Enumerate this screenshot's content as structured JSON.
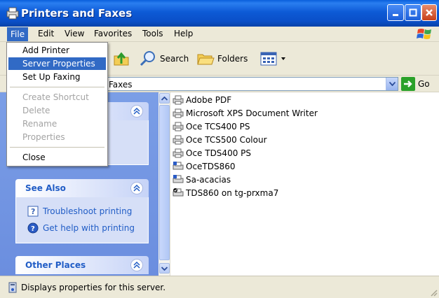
{
  "window": {
    "title": "Printers and Faxes"
  },
  "menubar": {
    "items": [
      {
        "label": "File"
      },
      {
        "label": "Edit"
      },
      {
        "label": "View"
      },
      {
        "label": "Favorites"
      },
      {
        "label": "Tools"
      },
      {
        "label": "Help"
      }
    ]
  },
  "toolbar": {
    "search_label": "Search",
    "folders_label": "Folders"
  },
  "address": {
    "value": "Faxes",
    "go_label": "Go"
  },
  "file_menu": {
    "items": [
      {
        "label": "Add Printer",
        "enabled": true,
        "highlighted": false
      },
      {
        "label": "Server Properties",
        "enabled": true,
        "highlighted": true
      },
      {
        "label": "Set Up Faxing",
        "enabled": true,
        "highlighted": false
      },
      {
        "label": "Create Shortcut",
        "enabled": false,
        "highlighted": false
      },
      {
        "label": "Delete",
        "enabled": false,
        "highlighted": false
      },
      {
        "label": "Rename",
        "enabled": false,
        "highlighted": false
      },
      {
        "label": "Properties",
        "enabled": false,
        "highlighted": false
      },
      {
        "label": "Close",
        "enabled": true,
        "highlighted": false
      }
    ]
  },
  "taskpane": {
    "see_also": {
      "title": "See Also",
      "links": [
        {
          "label": "Troubleshoot printing"
        },
        {
          "label": "Get help with printing"
        }
      ]
    },
    "other_places": {
      "title": "Other Places"
    }
  },
  "printers": [
    {
      "name": "Adobe PDF"
    },
    {
      "name": "Microsoft XPS Document Writer"
    },
    {
      "name": "Oce TCS400 PS"
    },
    {
      "name": "Oce TCS500 Colour"
    },
    {
      "name": "Oce TDS400 PS"
    },
    {
      "name": "OceTDS860"
    },
    {
      "name": "Sa-acacias"
    },
    {
      "name": "TDS860 on tg-prxma7"
    }
  ],
  "status": {
    "text": "Displays properties for this server."
  },
  "colors": {
    "titlebar": "#0a4fc8",
    "menu_highlight": "#316ac5",
    "taskpane": "#7b9ee6",
    "link": "#215dc6"
  }
}
